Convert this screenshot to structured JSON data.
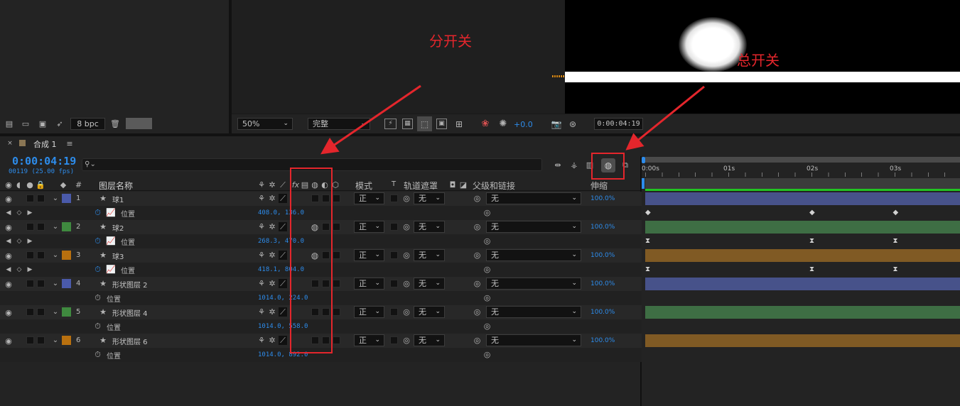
{
  "project_footer": {
    "bpc_label": "8 bpc"
  },
  "viewer_toolbar": {
    "zoom": "50%",
    "resolution": "完整",
    "exposure": "+0.0",
    "timecode": "0:00:04:19"
  },
  "annotations": {
    "sub_switch": "分开关",
    "master_switch": "总开关"
  },
  "comp_tab": {
    "name": "合成 1",
    "menu_icon": "hamburger-icon"
  },
  "timeline": {
    "current_time": "0:00:04:19",
    "frame_info": "00119 (25.00 fps)",
    "search_placeholder": "",
    "headers": {
      "hash": "#",
      "layer_name": "图层名称",
      "mode": "模式",
      "track_t": "T",
      "track_matte": "轨道遮罩",
      "parent": "父级和链接",
      "stretch": "伸缩"
    },
    "ruler": [
      "0:00s",
      "01s",
      "02s",
      "03s"
    ]
  },
  "layers": [
    {
      "index": "1",
      "name": "球1",
      "mode": "正",
      "matte": "无",
      "parent": "无",
      "stretch": "100.0%",
      "color": "#4a5aaa",
      "motion_blur": false,
      "sub": {
        "label": "位置",
        "value": "408.0, 136.0",
        "graph": true,
        "keyframes": "diamond"
      }
    },
    {
      "index": "2",
      "name": "球2",
      "mode": "正",
      "matte": "无",
      "parent": "无",
      "stretch": "100.0%",
      "color": "#3f8a3f",
      "motion_blur": true,
      "sub": {
        "label": "位置",
        "value": "268.3, 470.0",
        "graph": true,
        "keyframes": "hourglass"
      }
    },
    {
      "index": "3",
      "name": "球3",
      "mode": "正",
      "matte": "无",
      "parent": "无",
      "stretch": "100.0%",
      "color": "#b8700f",
      "motion_blur": true,
      "sub": {
        "label": "位置",
        "value": "418.1, 804.0",
        "graph": true,
        "keyframes": "hourglass"
      }
    },
    {
      "index": "4",
      "name": "形状图层 2",
      "mode": "正",
      "matte": "无",
      "parent": "无",
      "stretch": "100.0%",
      "color": "#4a5aaa",
      "motion_blur": false,
      "sub": {
        "label": "位置",
        "value": "1014.0, 224.0",
        "graph": false,
        "keyframes": "none"
      }
    },
    {
      "index": "5",
      "name": "形状图层 4",
      "mode": "正",
      "matte": "无",
      "parent": "无",
      "stretch": "100.0%",
      "color": "#3f8a3f",
      "motion_blur": false,
      "sub": {
        "label": "位置",
        "value": "1014.0, 558.0",
        "graph": false,
        "keyframes": "none"
      }
    },
    {
      "index": "6",
      "name": "形状图层 6",
      "mode": "正",
      "matte": "无",
      "parent": "无",
      "stretch": "100.0%",
      "color": "#b8700f",
      "motion_blur": false,
      "sub": {
        "label": "位置",
        "value": "1014.0, 892.0",
        "graph": false,
        "keyframes": "none"
      }
    }
  ],
  "keyframe_times_s": [
    0,
    2,
    3
  ],
  "colors": {
    "accent": "#2d8ceb",
    "annotation": "#e4262c",
    "work_area_bar": "#22c422",
    "bar_blue": "#47528a",
    "bar_green": "#3e6e44",
    "bar_orange": "#805a24"
  }
}
